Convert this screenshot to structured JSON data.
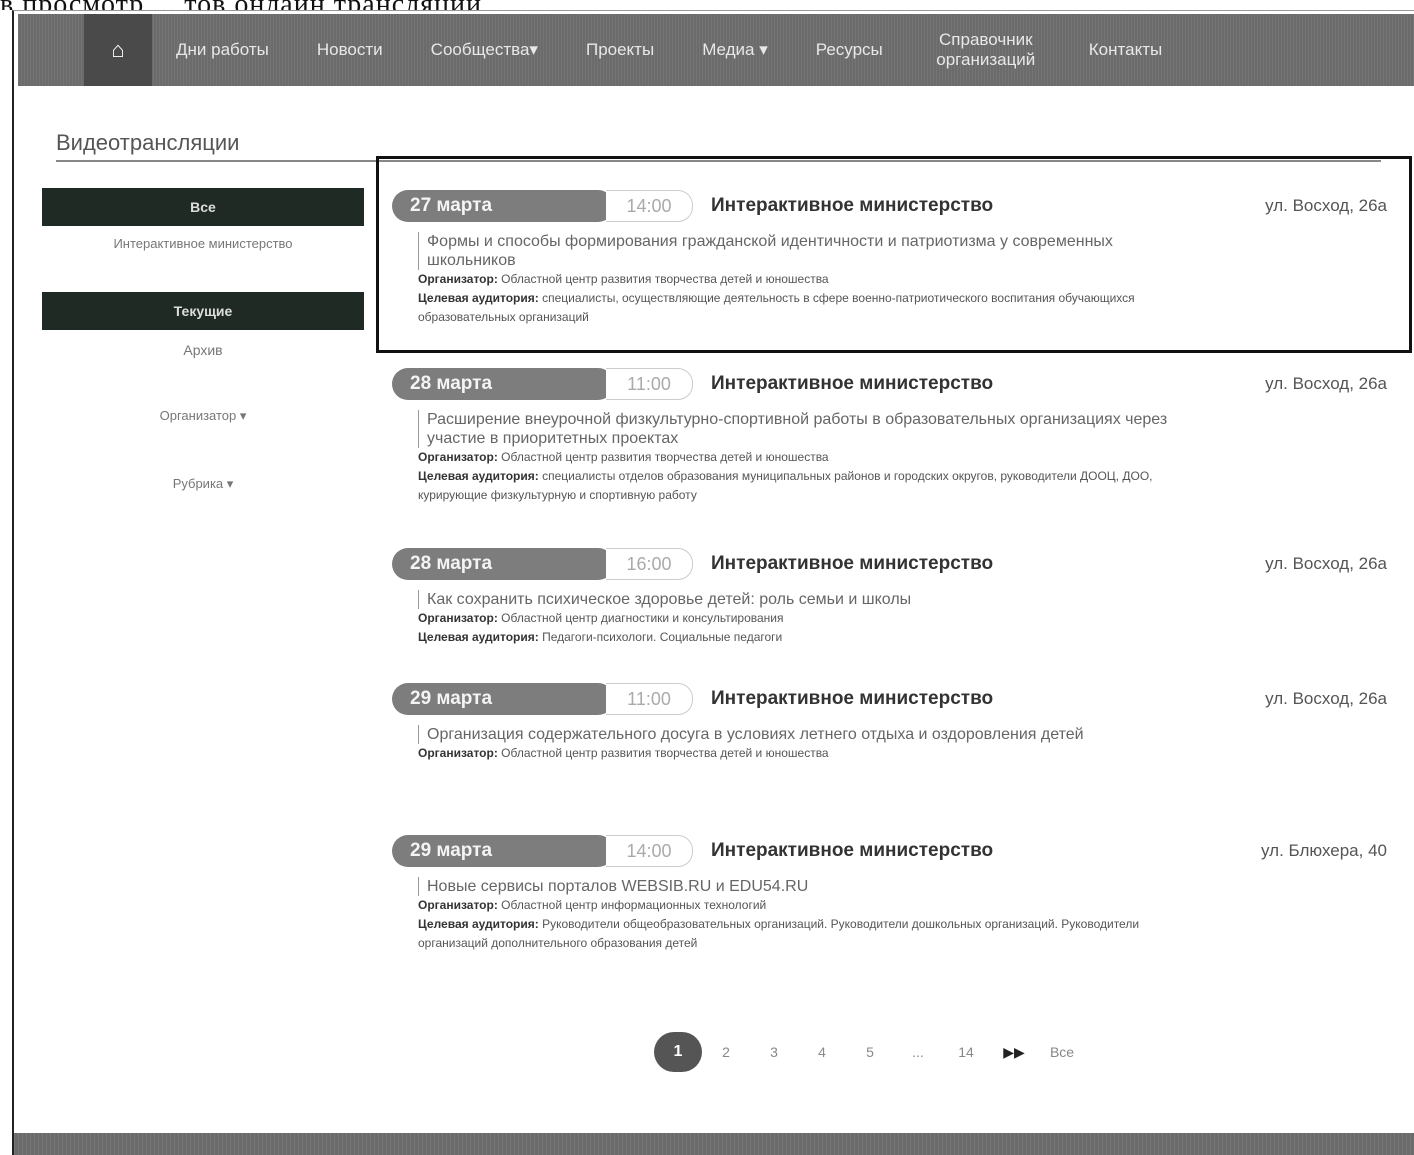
{
  "top_fragment": "в просмотр ... тов онлайн трансляций",
  "nav": {
    "home_icon": "home-icon",
    "items": [
      {
        "label": "Дни работы"
      },
      {
        "label": "Новости"
      },
      {
        "label": "Сообщества▾"
      },
      {
        "label": "Проекты"
      },
      {
        "label": "Медиа ▾"
      },
      {
        "label": "Ресурсы"
      },
      {
        "label": "Справочник организаций"
      },
      {
        "label": "Контакты"
      }
    ]
  },
  "page": {
    "title": "Видеотрансляции"
  },
  "sidebar": {
    "all_button": "Все",
    "all_caption": "Интерактивное министерство",
    "current_button": "Текущие",
    "archive_link": "Архив",
    "organizer_filter": "Организатор ▾",
    "rubric_filter": "Рубрика ▾"
  },
  "events": [
    {
      "date": "27 марта",
      "time": "14:00",
      "title": "Интерактивное министерство",
      "address": "ул. Восход, 26а",
      "description": "Формы и способы формирования гражданской идентичности и патриотизма у современных школьников",
      "organizer_label": "Организатор:",
      "organizer": "Областной центр развития творчества детей и юношества",
      "audience_label": "Целевая аудитория:",
      "audience": "специалисты, осуществляющие деятельность в сфере военно-патриотического воспитания обучающихся образовательных организаций"
    },
    {
      "date": "28 марта",
      "time": "11:00",
      "title": "Интерактивное министерство",
      "address": "ул. Восход, 26а",
      "description": "Расширение внеурочной физкультурно-спортивной работы в образовательных организациях через участие в приоритетных проектах",
      "organizer_label": "Организатор:",
      "organizer": "Областной центр развития творчества детей и юношества",
      "audience_label": "Целевая аудитория:",
      "audience": "специалисты отделов образования муниципальных районов и городских округов, руководители ДООЦ, ДОО, курирующие физкультурную и спортивную работу"
    },
    {
      "date": "28 марта",
      "time": "16:00",
      "title": "Интерактивное министерство",
      "address": "ул. Восход, 26а",
      "description": "Как сохранить психическое здоровье детей: роль семьи и школы",
      "organizer_label": "Организатор:",
      "organizer": "Областной центр диагностики и консультирования",
      "audience_label": "Целевая аудитория:",
      "audience": "Педагоги-психологи. Социальные педагоги"
    },
    {
      "date": "29 марта",
      "time": "11:00",
      "title": "Интерактивное министерство",
      "address": "ул. Восход, 26а",
      "description": "Организация содержательного досуга в условиях летнего отдыха и оздоровления детей",
      "organizer_label": "Организатор:",
      "organizer": "Областной центр развития творчества детей и юношества",
      "audience_label": "",
      "audience": ""
    },
    {
      "date": "29 марта",
      "time": "14:00",
      "title": "Интерактивное министерство",
      "address": "ул. Блюхера, 40",
      "description": "Новые сервисы порталов WEBSIB.RU и EDU54.RU",
      "organizer_label": "Организатор:",
      "organizer": "Областной центр информационных технологий",
      "audience_label": "Целевая аудитория:",
      "audience": "Руководители общеобразовательных организаций. Руководители дошкольных организаций. Руководители организаций дополнительного образования детей"
    }
  ],
  "pagination": {
    "pages": [
      "1",
      "2",
      "3",
      "4",
      "5",
      "...",
      "14",
      "▶▶",
      "Все"
    ],
    "active": "1"
  }
}
